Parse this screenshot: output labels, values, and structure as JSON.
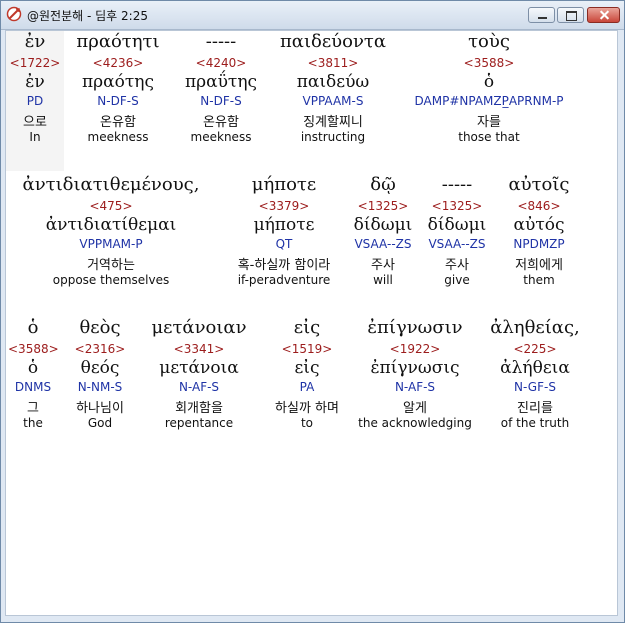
{
  "window": {
    "title": "@원전분해 - 딤후 2:25"
  },
  "rows": [
    [
      {
        "g1": "ἐν",
        "num": "<1722>",
        "g2": "ἐν",
        "code": "PD",
        "kor": "으로",
        "eng": "In"
      },
      {
        "g1": "πραότητι",
        "num": "<4236>",
        "g2": "πραότης",
        "code": "N-DF-S",
        "kor": "온유함",
        "eng": "meekness"
      },
      {
        "g1": "-----",
        "num": "<4240>",
        "g2": "πραΰτης",
        "code": "N-DF-S",
        "kor": "온유함",
        "eng": "meekness"
      },
      {
        "g1": "παιδεύοντα",
        "num": "<3811>",
        "g2": "παιδεύω",
        "code": "VPPAAM-S",
        "kor": "징계할찌니",
        "eng": "instructing"
      },
      {
        "g1": "τοὺς",
        "num": "<3588>",
        "g2": "ὁ",
        "code": "DAMP#NPAMZP̲APRNM-P",
        "kor": "자를",
        "eng": "those that"
      }
    ],
    [
      {
        "g1": "ἀντιδιατιθεμένους,",
        "num": "<475>",
        "g2": "ἀντιδιατίθεμαι",
        "code": "VPPMAM-P",
        "kor": "거역하는",
        "eng": "oppose themselves"
      },
      {
        "g1": "μήποτε",
        "num": "<3379>",
        "g2": "μήποτε",
        "code": "QT",
        "kor": "혹-하실까 함이라",
        "eng": "if-peradventure"
      },
      {
        "g1": "δῷ",
        "num": "<1325>",
        "g2": "δίδωμι",
        "code": "VSAA--ZS",
        "kor": "주사",
        "eng": "will"
      },
      {
        "g1": "-----",
        "num": "<1325>",
        "g2": "δίδωμι",
        "code": "VSAA--ZS",
        "kor": "주사",
        "eng": "give"
      },
      {
        "g1": "αὐτοῖς",
        "num": "<846>",
        "g2": "αὐτός",
        "code": "NPDMZP",
        "kor": "저희에게",
        "eng": "them"
      }
    ],
    [
      {
        "g1": "ὁ",
        "num": "<3588>",
        "g2": "ὁ",
        "code": "DNMS",
        "kor": "그",
        "eng": "the"
      },
      {
        "g1": "θεὸς",
        "num": "<2316>",
        "g2": "θεός",
        "code": "N-NM-S",
        "kor": "하나님이",
        "eng": "God"
      },
      {
        "g1": "μετάνοιαν",
        "num": "<3341>",
        "g2": "μετάνοια",
        "code": "N-AF-S",
        "kor": "회개함을",
        "eng": "repentance"
      },
      {
        "g1": "εἰς",
        "num": "<1519>",
        "g2": "εἰς",
        "code": "PA",
        "kor": "하실까 하며",
        "eng": "to"
      },
      {
        "g1": "ἐπίγνωσιν",
        "num": "<1922>",
        "g2": "ἐπίγνωσις",
        "code": "N-AF-S",
        "kor": "알게",
        "eng": "the acknowledging"
      },
      {
        "g1": "ἀληθείας,",
        "num": "<225>",
        "g2": "ἀλήθεια",
        "code": "N-GF-S",
        "kor": "진리를",
        "eng": "of the truth"
      }
    ]
  ]
}
